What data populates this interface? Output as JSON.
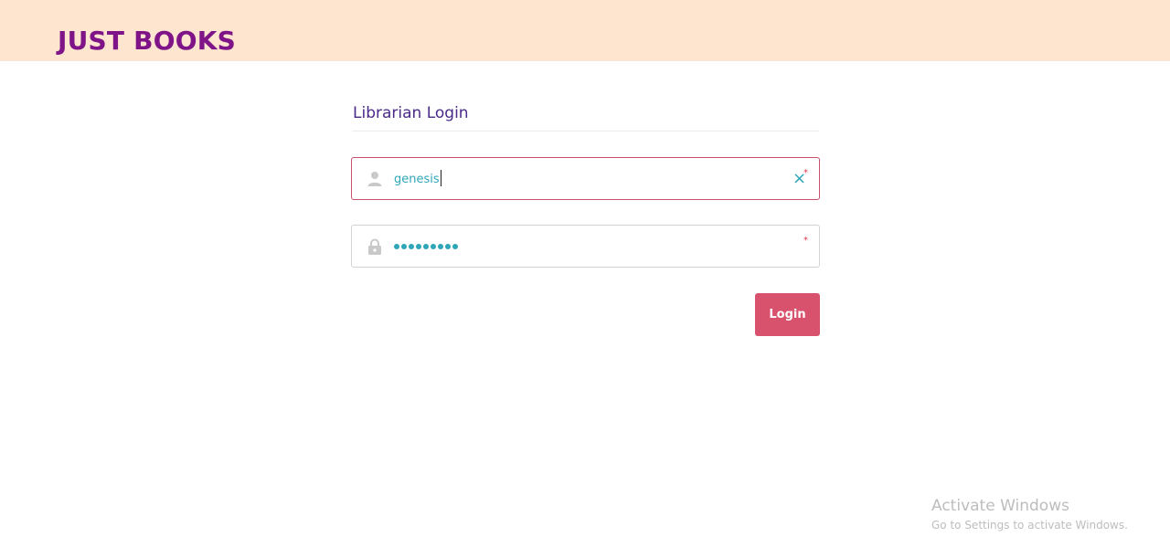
{
  "header": {
    "brand": "JUST BOOKS",
    "background_color": "#fde5cf",
    "brand_color": "#7e1487"
  },
  "login_form": {
    "title": "Librarian Login",
    "username": {
      "value": "genesis",
      "icon": "user-icon",
      "clear_icon": "clear-x-icon",
      "required_marker": "*"
    },
    "password": {
      "masked_length": 9,
      "icon": "lock-icon",
      "required_marker": "*"
    },
    "submit_label": "Login",
    "accent_color": "#d9526d",
    "input_text_color": "#2fa6b8"
  },
  "watermark": {
    "title": "Activate Windows",
    "subtitle": "Go to Settings to activate Windows."
  }
}
